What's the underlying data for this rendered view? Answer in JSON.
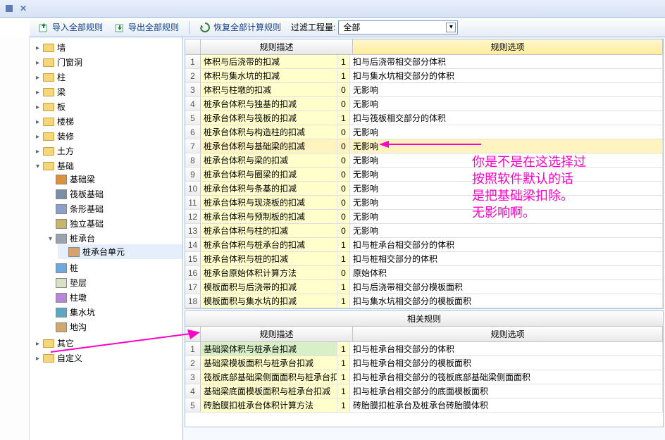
{
  "toolbar": {
    "import": "导入全部规则",
    "export": "导出全部规则",
    "restore": "恢复全部计算规则",
    "filter_label": "过滤工程量:",
    "filter_value": "全部"
  },
  "tree": {
    "nodes": [
      {
        "label": "墙",
        "exp": "▸",
        "folder": true
      },
      {
        "label": "门窗洞",
        "exp": "▸",
        "folder": true
      },
      {
        "label": "柱",
        "exp": "▸",
        "folder": true
      },
      {
        "label": "梁",
        "exp": "▸",
        "folder": true
      },
      {
        "label": "板",
        "exp": "▸",
        "folder": true
      },
      {
        "label": "楼梯",
        "exp": "▸",
        "folder": true
      },
      {
        "label": "装修",
        "exp": "▸",
        "folder": true
      },
      {
        "label": "土方",
        "exp": "▸",
        "folder": true
      },
      {
        "label": "基础",
        "exp": "▾",
        "folder": true,
        "children": [
          {
            "label": "基础梁",
            "icon": "#e08f3a"
          },
          {
            "label": "筏板基础",
            "icon": "#7a8ea6"
          },
          {
            "label": "条形基础",
            "icon": "#8aa0c8"
          },
          {
            "label": "独立基础",
            "icon": "#c7b56a"
          },
          {
            "label": "桩承台",
            "exp": "▾",
            "folder": false,
            "icon": "#9aa3ad",
            "children": [
              {
                "label": "桩承台单元",
                "icon": "#d7a36b",
                "sub": true
              }
            ]
          },
          {
            "label": "桩",
            "icon": "#6fa8dc"
          },
          {
            "label": "垫层",
            "icon": "#d9e1c4"
          },
          {
            "label": "柱墩",
            "icon": "#b786d8"
          },
          {
            "label": "集水坑",
            "icon": "#5ea7c2"
          },
          {
            "label": "地沟",
            "icon": "#cfa96c"
          }
        ]
      },
      {
        "label": "其它",
        "exp": "▸",
        "folder": true
      },
      {
        "label": "自定义",
        "exp": "▸",
        "folder": true
      }
    ]
  },
  "top_grid": {
    "headers": {
      "desc": "规则描述",
      "opt": "规则选项"
    },
    "rows": [
      {
        "n": 1,
        "desc": "体积与后浇带的扣减",
        "code": "1",
        "opt": "扣与后浇带相交部分体积"
      },
      {
        "n": 2,
        "desc": "体积与集水坑的扣减",
        "code": "1",
        "opt": "扣与集水坑相交部分的体积"
      },
      {
        "n": 3,
        "desc": "体积与柱墩的扣减",
        "code": "0",
        "opt": "无影响"
      },
      {
        "n": 4,
        "desc": "桩承台体积与独基的扣减",
        "code": "0",
        "opt": "无影响"
      },
      {
        "n": 5,
        "desc": "桩承台体积与筏板的扣减",
        "code": "1",
        "opt": "扣与筏板相交部分的体积"
      },
      {
        "n": 6,
        "desc": "桩承台体积与构造柱的扣减",
        "code": "0",
        "opt": "无影响"
      },
      {
        "n": 7,
        "desc": "桩承台体积与基础梁的扣减",
        "code": "0",
        "opt": "无影响",
        "sel": true
      },
      {
        "n": 8,
        "desc": "桩承台体积与梁的扣减",
        "code": "0",
        "opt": "无影响"
      },
      {
        "n": 9,
        "desc": "桩承台体积与圈梁的扣减",
        "code": "0",
        "opt": "无影响"
      },
      {
        "n": 10,
        "desc": "桩承台体积与条基的扣减",
        "code": "0",
        "opt": "无影响"
      },
      {
        "n": 11,
        "desc": "桩承台体积与现浇板的扣减",
        "code": "0",
        "opt": "无影响"
      },
      {
        "n": 12,
        "desc": "桩承台体积与预制板的扣减",
        "code": "0",
        "opt": "无影响"
      },
      {
        "n": 13,
        "desc": "桩承台体积与柱的扣减",
        "code": "0",
        "opt": "无影响"
      },
      {
        "n": 14,
        "desc": "桩承台体积与桩承台的扣减",
        "code": "1",
        "opt": "扣与桩承台相交部分的体积"
      },
      {
        "n": 15,
        "desc": "桩承台体积与桩的扣减",
        "code": "1",
        "opt": "扣与桩相交部分的体积"
      },
      {
        "n": 16,
        "desc": "桩承台原始体积计算方法",
        "code": "0",
        "opt": "原始体积"
      },
      {
        "n": 17,
        "desc": "模板面积与后浇带的扣减",
        "code": "1",
        "opt": "扣与后浇带相交部分模板面积"
      },
      {
        "n": 18,
        "desc": "模板面积与集水坑的扣减",
        "code": "1",
        "opt": "扣与集水坑相交部分的模板面积"
      }
    ]
  },
  "bottom_grid": {
    "section": "相关规则",
    "headers": {
      "desc": "规则描述",
      "opt": "规则选项"
    },
    "rows": [
      {
        "n": 1,
        "desc": "基础梁体积与桩承台扣减",
        "code": "1",
        "opt": "扣与桩承台相交部分的体积"
      },
      {
        "n": 2,
        "desc": "基础梁模板面积与桩承台扣减",
        "code": "1",
        "opt": "扣与桩承台相交部分的模板面积"
      },
      {
        "n": 3,
        "desc": "筏板底部基础梁侧面面积与桩承台扣",
        "code": "1",
        "opt": "扣与桩承台相交部分的筏板底部基础梁侧面面积"
      },
      {
        "n": 4,
        "desc": "基础梁底面模板面积与桩承台扣减",
        "code": "1",
        "opt": "扣与桩承台相交部分的底面模板面积"
      },
      {
        "n": 5,
        "desc": "砖胎膜扣桩承台体积计算方法",
        "code": "1",
        "opt": "砖胎膜扣桩承台及桩承台砖胎膜体积"
      }
    ]
  },
  "annotation": {
    "lines": [
      "你是不是在这选择过",
      "按照软件默认的话",
      "是把基础梁扣除。",
      "无影响啊。"
    ]
  }
}
